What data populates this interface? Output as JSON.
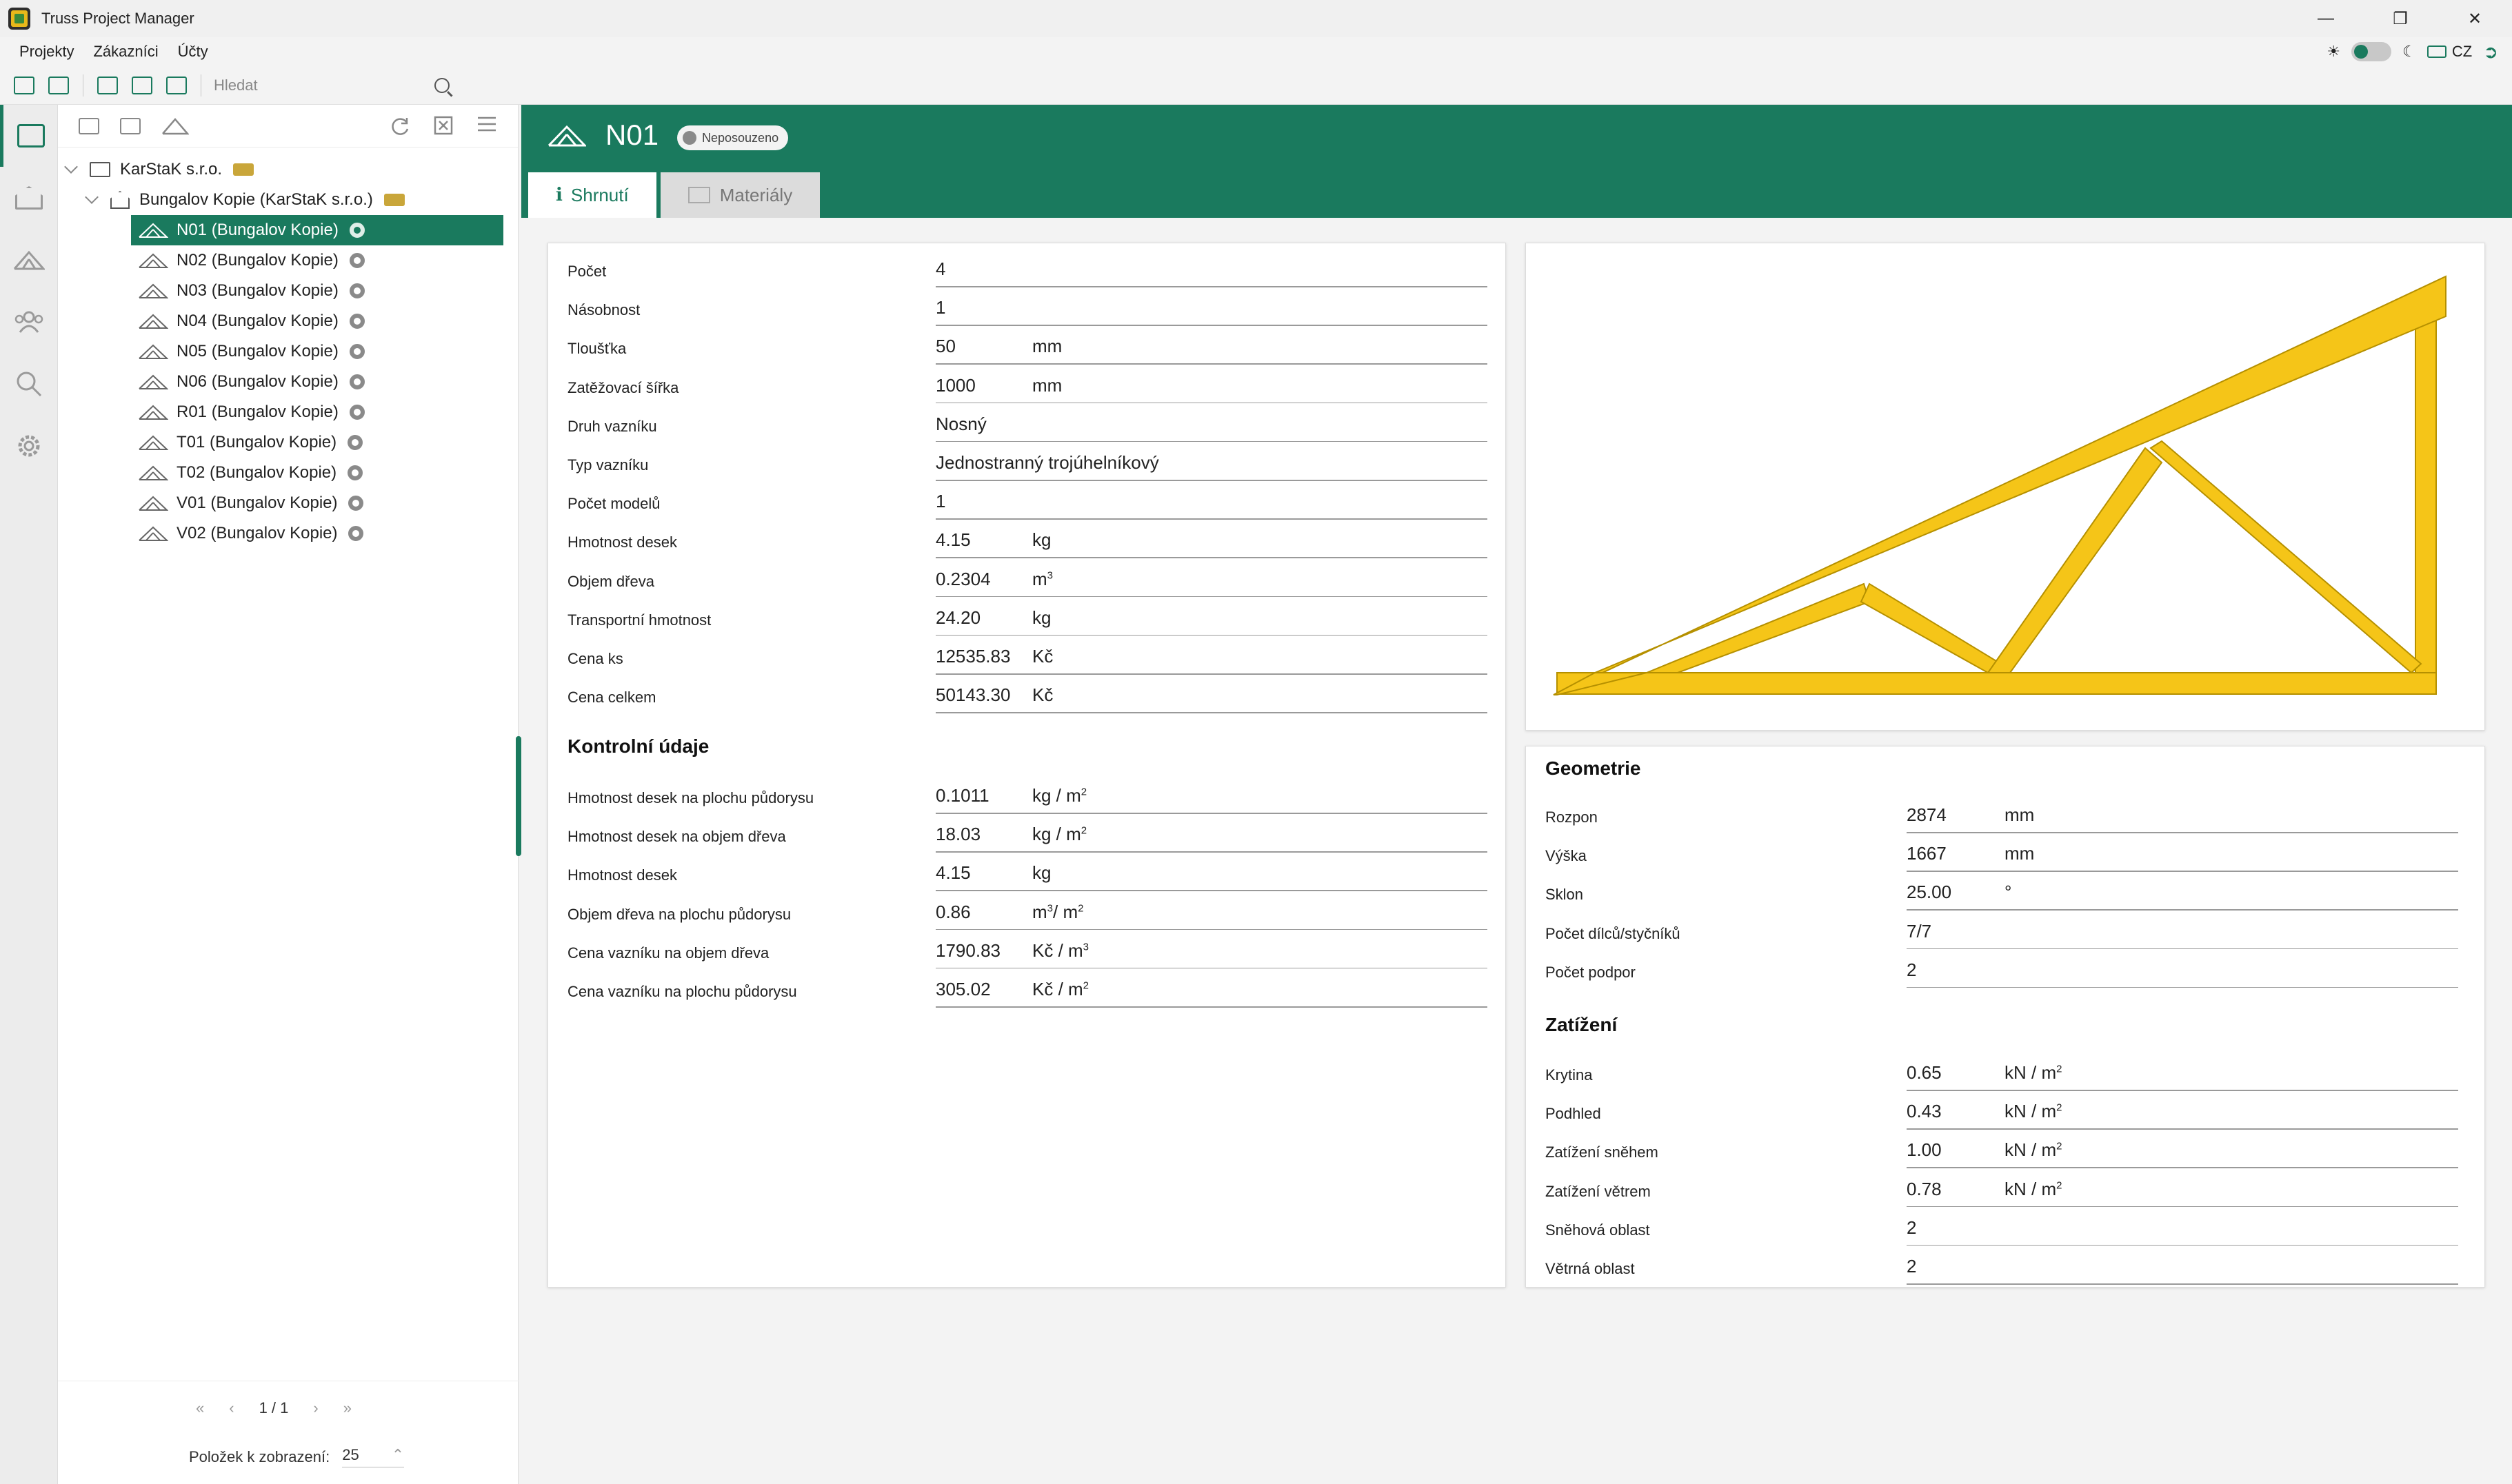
{
  "app": {
    "title": "Truss Project Manager",
    "menu": [
      "Projekty",
      "Zákazníci",
      "Účty"
    ],
    "language": "CZ"
  },
  "toolbar": {
    "search_placeholder": "Hledat"
  },
  "tree": {
    "company": "KarStaK s.r.o.",
    "project": "Bungalov Kopie (KarStaK s.r.o.)",
    "items": [
      {
        "label": "N01 (Bungalov Kopie)",
        "selected": true
      },
      {
        "label": "N02 (Bungalov Kopie)"
      },
      {
        "label": "N03 (Bungalov Kopie)"
      },
      {
        "label": "N04 (Bungalov Kopie)"
      },
      {
        "label": "N05 (Bungalov Kopie)"
      },
      {
        "label": "N06 (Bungalov Kopie)"
      },
      {
        "label": "R01 (Bungalov Kopie)"
      },
      {
        "label": "T01 (Bungalov Kopie)"
      },
      {
        "label": "T02 (Bungalov Kopie)"
      },
      {
        "label": "V01 (Bungalov Kopie)"
      },
      {
        "label": "V02 (Bungalov Kopie)"
      }
    ],
    "pager": {
      "first": "«",
      "prev": "‹",
      "page": "1 / 1",
      "next": "›",
      "last": "»"
    },
    "per_page_label": "Položek k zobrazení:",
    "per_page_value": "25"
  },
  "header": {
    "title": "N01",
    "status": "Neposouzeno",
    "tabs": [
      "Shrnutí",
      "Materiály"
    ]
  },
  "summary": {
    "rows": [
      {
        "label": "Počet",
        "value": "4",
        "unit": ""
      },
      {
        "label": "Násobnost",
        "value": "1",
        "unit": ""
      },
      {
        "label": "Tloušťka",
        "value": "50",
        "unit": "mm"
      },
      {
        "label": "Zatěžovací šířka",
        "value": "1000",
        "unit": "mm"
      },
      {
        "label": "Druh vazníku",
        "value": "Nosný",
        "unit": ""
      },
      {
        "label": "Typ vazníku",
        "value": "Jednostranný trojúhelníkový",
        "unit": ""
      },
      {
        "label": "Počet modelů",
        "value": "1",
        "unit": ""
      },
      {
        "label": "Hmotnost desek",
        "value": "4.15",
        "unit": "kg"
      },
      {
        "label": "Objem dřeva",
        "value": "0.2304",
        "unit": "m",
        "sup": "3"
      },
      {
        "label": "Transportní hmotnost",
        "value": "24.20",
        "unit": "kg"
      },
      {
        "label": "Cena ks",
        "value": "12535.83",
        "unit": "Kč"
      },
      {
        "label": "Cena celkem",
        "value": "50143.30",
        "unit": "Kč"
      }
    ],
    "control_title": "Kontrolní údaje",
    "control_rows": [
      {
        "label": "Hmotnost desek na plochu půdorysu",
        "value": "0.1011",
        "unit": "kg / m",
        "sup": "2"
      },
      {
        "label": "Hmotnost desek na objem dřeva",
        "value": "18.03",
        "unit": "kg / m",
        "sup": "2"
      },
      {
        "label": "Hmotnost desek",
        "value": "4.15",
        "unit": "kg"
      },
      {
        "label": "Objem dřeva na plochu půdorysu",
        "value": "0.86",
        "unit": "m",
        "sup": "3",
        "unit2": "/ m",
        "sup2": "2"
      },
      {
        "label": "Cena vazníku na objem dřeva",
        "value": "1790.83",
        "unit": "Kč / m",
        "sup": "3"
      },
      {
        "label": "Cena vazníku na plochu půdorysu",
        "value": "305.02",
        "unit": "Kč / m",
        "sup": "2"
      }
    ]
  },
  "geometry": {
    "title": "Geometrie",
    "rows": [
      {
        "label": "Rozpon",
        "value": "2874",
        "unit": "mm"
      },
      {
        "label": "Výška",
        "value": "1667",
        "unit": "mm"
      },
      {
        "label": "Sklon",
        "value": "25.00",
        "unit": "°"
      },
      {
        "label": "Počet dílců/styčníků",
        "value": "7/7",
        "unit": ""
      },
      {
        "label": "Počet podpor",
        "value": "2",
        "unit": ""
      }
    ],
    "load_title": "Zatížení",
    "load_rows": [
      {
        "label": "Krytina",
        "value": "0.65",
        "unit": "kN / m",
        "sup": "2"
      },
      {
        "label": "Podhled",
        "value": "0.43",
        "unit": "kN / m",
        "sup": "2"
      },
      {
        "label": "Zatížení sněhem",
        "value": "1.00",
        "unit": "kN / m",
        "sup": "2"
      },
      {
        "label": "Zatížení větrem",
        "value": "0.78",
        "unit": "kN / m",
        "sup": "2"
      },
      {
        "label": "Sněhová oblast",
        "value": "2",
        "unit": ""
      },
      {
        "label": "Větrná oblast",
        "value": "2",
        "unit": ""
      }
    ]
  },
  "colors": {
    "accent": "#1a7a5e",
    "truss_fill": "#f5c518",
    "truss_stroke": "#b59000"
  }
}
